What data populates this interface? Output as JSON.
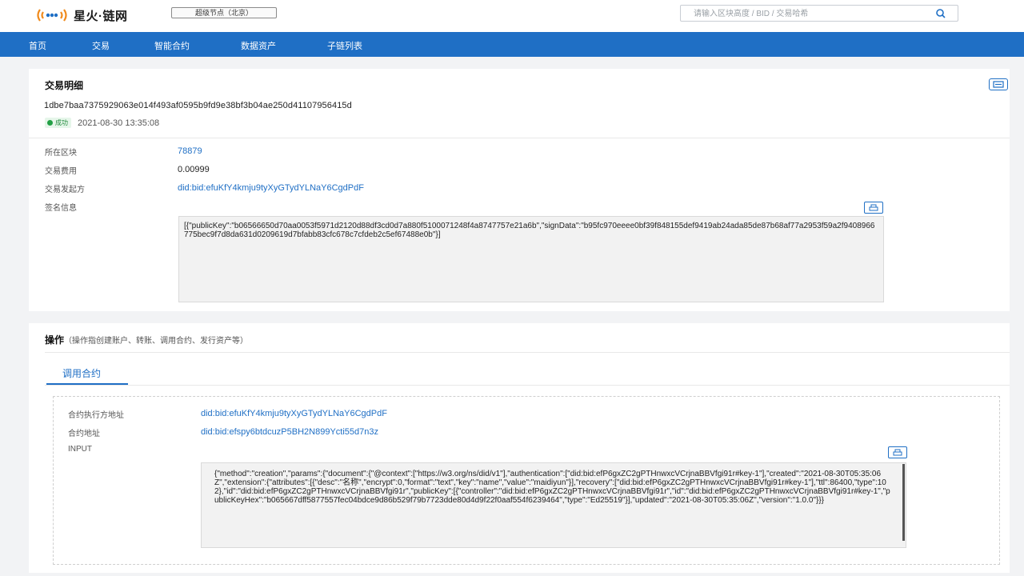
{
  "header": {
    "brand": "星火·链网",
    "node_tag": "超级节点（北京）",
    "search_placeholder": "请输入区块高度 / BID / 交易哈希"
  },
  "nav": {
    "items": [
      "首页",
      "交易",
      "智能合约",
      "数据资产",
      "子链列表"
    ]
  },
  "detail": {
    "title": "交易明细",
    "hash": "1dbe7baa7375929063e014f493af0595b9fd9e38bf3b04ae250d41107956415d",
    "status": "成功",
    "time": "2021-08-30 13:35:08",
    "fields": {
      "block_label": "所在区块",
      "block_value": "78879",
      "fee_label": "交易费用",
      "fee_value": "0.00999",
      "sender_label": "交易发起方",
      "sender_value": "did:bid:efuKfY4kmju9tyXyGTydYLNaY6CgdPdF",
      "sign_label": "签名信息"
    },
    "sign_info": "[{\"publicKey\":\"b06566650d70aa0053f5971d2120d88df3cd0d7a880f5100071248f4a8747757e21a6b\",\"signData\":\"b95fc970eeee0bf39f848155def9419ab24ada85de87b68af77a2953f59a2f9408966775bec9f7d8da631d0209619d7bfabb83cfc678c7cfdeb2c5ef67488e0b\"}]"
  },
  "operation": {
    "title": "操作",
    "subtitle": "（操作指创建账户、转账、调用合约、发行资产等）",
    "tab": "调用合约",
    "fields": {
      "executor_label": "合约执行方地址",
      "executor_value": "did:bid:efuKfY4kmju9tyXyGTydYLNaY6CgdPdF",
      "contract_label": "合约地址",
      "contract_value": "did:bid:efspy6btdcuzP5BH2N899Ycti55d7n3z",
      "input_label": "INPUT"
    },
    "input": "{\"method\":\"creation\",\"params\":{\"document\":{\"@context\":[\"https://w3.org/ns/did/v1\"],\"authentication\":[\"did:bid:efP6gxZC2gPTHnwxcVCrjnaBBVfgi91r#key-1\"],\"created\":\"2021-08-30T05:35:06Z\",\"extension\":{\"attributes\":[{\"desc\":\"名称\",\"encrypt\":0,\"format\":\"text\",\"key\":\"name\",\"value\":\"maidiyun\"}],\"recovery\":[\"did:bid:efP6gxZC2gPTHnwxcVCrjnaBBVfgi91r#key-1\"],\"ttl\":86400,\"type\":102},\"id\":\"did:bid:efP6gxZC2gPTHnwxcVCrjnaBBVfgi91r\",\"publicKey\":[{\"controller\":\"did:bid:efP6gxZC2gPTHnwxcVCrjnaBBVfgi91r\",\"id\":\"did:bid:efP6gxZC2gPTHnwxcVCrjnaBBVfgi91r#key-1\",\"publicKeyHex\":\"b065667dff5877557fec04bdce9d86b529f79b7723dde80d4d9f22f0aaf554f6239464\",\"type\":\"Ed25519\"}],\"updated\":\"2021-08-30T05:35:06Z\",\"version\":\"1.0.0\"}}}"
  },
  "colors": {
    "primary": "#1f6fc5",
    "success": "#22a045",
    "background": "#f2f3f5"
  }
}
